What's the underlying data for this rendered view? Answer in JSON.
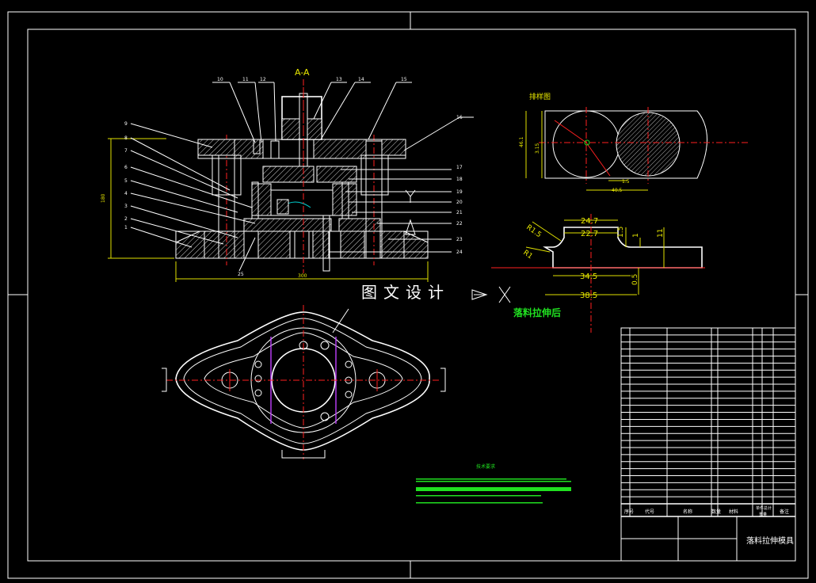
{
  "section_label": "A-A",
  "blank_view_title": "排样图",
  "drawn_part_title": "落料拉伸后",
  "watermark": "图文设计",
  "drawing_title": "落料拉伸模具",
  "tech_req_title": "技术要求",
  "dimensions": {
    "top_width": "24.7",
    "mid_width": "22.7",
    "bottom_width": "34.5",
    "overall_width": "38.5",
    "height_1": "1.5",
    "height_2": "1",
    "height_3": "11",
    "height_4": "0.5",
    "radius_1": "R1.5",
    "radius_2": "R1"
  },
  "part_numbers": [
    "18",
    "11",
    "12",
    "13",
    "14",
    "15",
    "16",
    "17",
    "18",
    "19",
    "20",
    "21",
    "22",
    "23",
    "24",
    "25",
    "9",
    "8",
    "7",
    "6",
    "5",
    "4",
    "3",
    "2",
    "1"
  ],
  "title_block_headers": [
    "序号",
    "代号",
    "名称",
    "数量",
    "材料",
    "单件重量",
    "总计重量",
    "备注"
  ],
  "colors": {
    "background": "#000000",
    "outline": "#ffffff",
    "centerline": "#ff2020",
    "annotation": "#e0e000",
    "text_green": "#20e020",
    "hidden": "#00d0d0",
    "highlight": "#c040ff"
  }
}
